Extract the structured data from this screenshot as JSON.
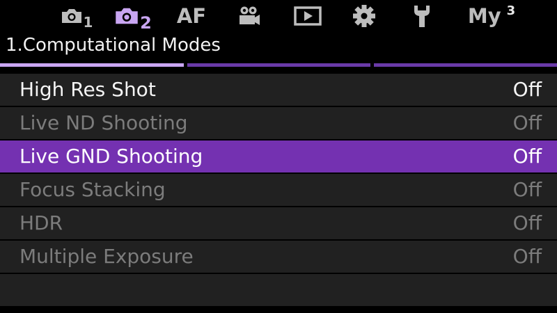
{
  "tabs": [
    {
      "id": "shooting1",
      "icon": "camera-icon",
      "sub": "1",
      "active": false
    },
    {
      "id": "shooting2",
      "icon": "camera-icon",
      "sub": "2",
      "active": true
    },
    {
      "id": "af",
      "label": "AF",
      "active": false
    },
    {
      "id": "video",
      "icon": "video-camera-icon",
      "active": false
    },
    {
      "id": "playback",
      "icon": "playback-icon",
      "active": false
    },
    {
      "id": "custom",
      "icon": "gear-icon",
      "active": false
    },
    {
      "id": "setup",
      "icon": "wrench-icon",
      "active": false
    },
    {
      "id": "mymenu",
      "label": "My",
      "sup": "3",
      "active": false
    }
  ],
  "page": {
    "title": "1.Computational Modes",
    "indicator_active_index": 0
  },
  "menu": {
    "items": [
      {
        "label": "High Res Shot",
        "value": "Off",
        "state": "enabled"
      },
      {
        "label": "Live ND Shooting",
        "value": "Off",
        "state": "disabled"
      },
      {
        "label": "Live GND Shooting",
        "value": "Off",
        "state": "selected"
      },
      {
        "label": "Focus Stacking",
        "value": "Off",
        "state": "disabled"
      },
      {
        "label": "HDR",
        "value": "Off",
        "state": "disabled"
      },
      {
        "label": "Multiple Exposure",
        "value": "Off",
        "state": "disabled"
      }
    ]
  },
  "colors": {
    "accent": "#c9a6f2",
    "selection": "#7431b1",
    "indicator_inactive": "#6a3aa8",
    "row_bg": "#212121"
  }
}
